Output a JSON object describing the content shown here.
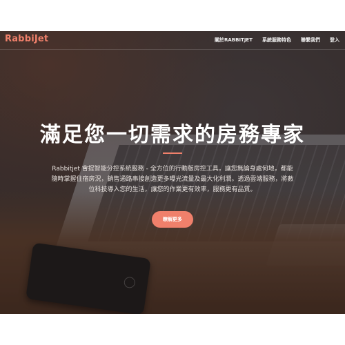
{
  "brand": {
    "logo_text": "RabbiJet",
    "accent_color": "#f0806b"
  },
  "nav": {
    "items": [
      {
        "label": "關於RABBITJET"
      },
      {
        "label": "系統服務特色"
      },
      {
        "label": "聯繫我們"
      },
      {
        "label": "登入"
      }
    ]
  },
  "hero": {
    "title": "滿足您一切需求的房務專家",
    "description_lines": [
      "Rabbitjet 會提智能分控系統服務 - 全方位的行動版房控工具，讓您無論身處何地，都能",
      "隨時掌握住宿房況，銷售通路串接創造更多曝光流量及最大化利潤。透過雲端服務，將數",
      "位科技導入您的生活，讓您的作業更有效率，服務更有品質。"
    ],
    "cta_label": "瞭解更多"
  },
  "colors": {
    "text_white": "#ffffff",
    "overlay": "#3b3534"
  }
}
